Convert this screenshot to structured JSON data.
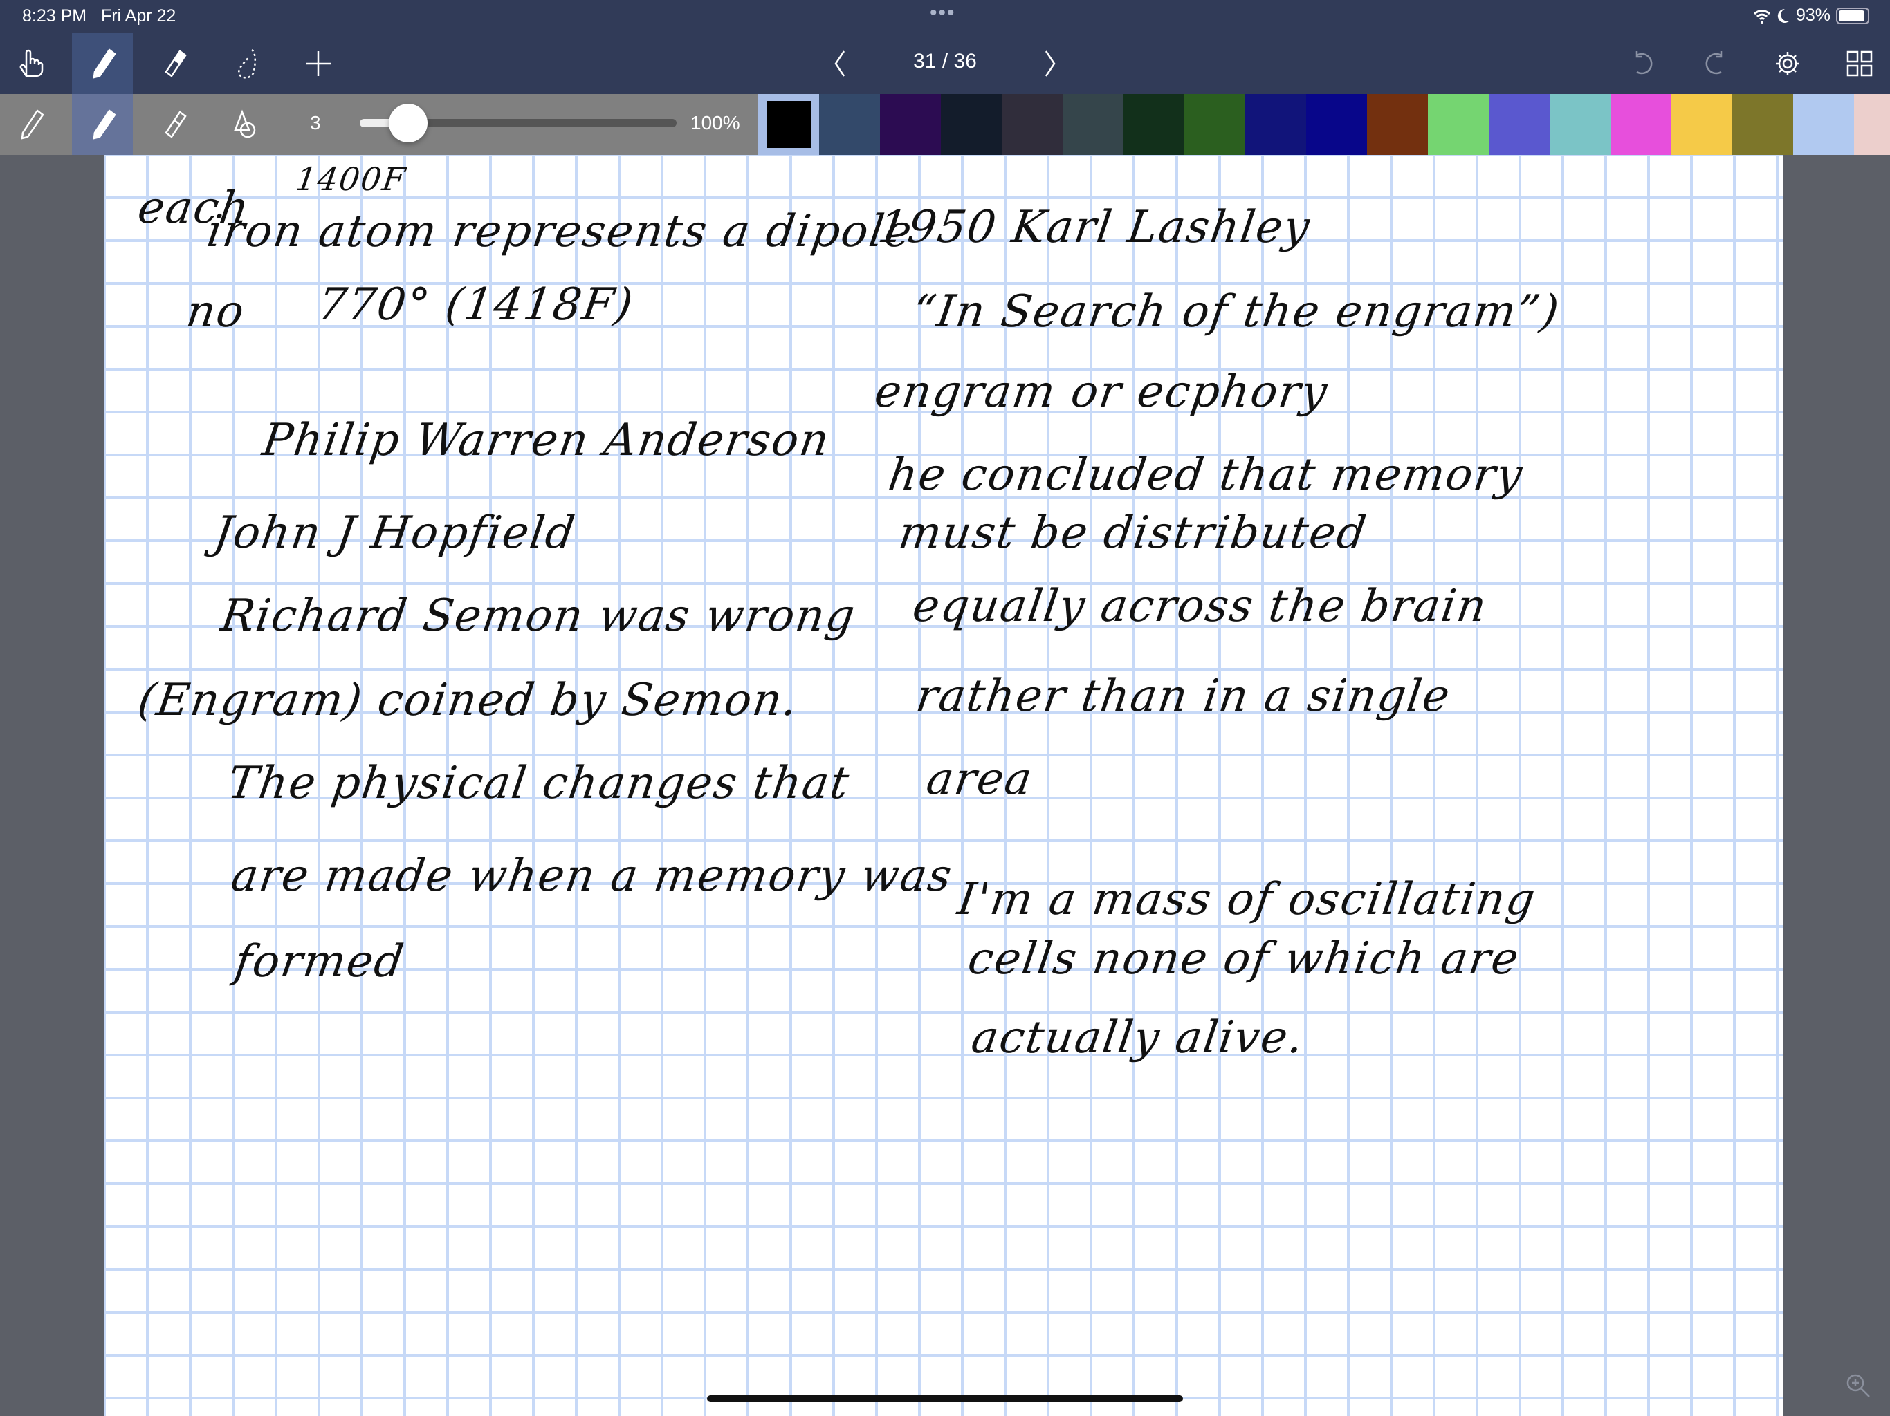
{
  "status": {
    "time": "8:23 PM",
    "date": "Fri Apr 22",
    "dots": "•••",
    "battery": "93%"
  },
  "toolbar": {
    "page_indicator": "31 / 36",
    "pen_size": "3",
    "pen_size_value": 3,
    "opacity": "100%",
    "opacity_value": 100
  },
  "palette": [
    "#000000",
    "#33496a",
    "#2c0c52",
    "#131c2b",
    "#302d3b",
    "#35454b",
    "#12301b",
    "#2b5f1f",
    "#11147a",
    "#08068a",
    "#73300f",
    "#75d571",
    "#5a58cf",
    "#7bc4c6",
    "#e74fdc",
    "#f5ca48",
    "#7d762a",
    "#b1c9f0",
    "#eccfcc"
  ],
  "selected_color": "#000000",
  "notes": {
    "left": [
      "1400F",
      "each",
      "iron atom represents a dipole",
      "no",
      "770° (1418F)",
      "Philip Warren Anderson",
      "John J Hopfield",
      "Richard Semon was wrong",
      "(Engram) coined by Semon.",
      "The physical changes that",
      "are made when a memory was",
      "formed"
    ],
    "right": [
      "1950 Karl Lashley",
      "“In Search of the engram”)",
      "engram or ecphory",
      "he concluded that memory",
      "must be distributed",
      "equally across the brain",
      "rather than in a single",
      "area",
      "I'm a mass of oscillating",
      "cells none of which are",
      "actually alive."
    ]
  }
}
